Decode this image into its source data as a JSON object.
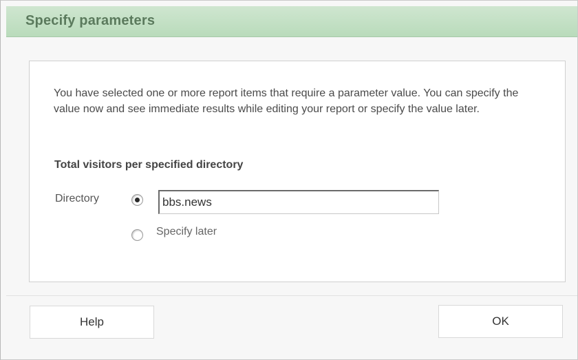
{
  "dialog": {
    "title": "Specify parameters"
  },
  "content": {
    "description": "You have selected one or more report items that require a parameter value. You can specify the value now and see immediate results while editing your report or specify the value later.",
    "heading": "Total visitors per specified directory",
    "parameter": {
      "label": "Directory",
      "value": "bbs.news",
      "option_now_selected": true,
      "option_later_label": "Specify later"
    }
  },
  "buttons": {
    "help_label": "Help",
    "ok_label": "OK"
  },
  "colors": {
    "title_bar": "#b9dbbb",
    "title_text": "#5b7a5d"
  }
}
